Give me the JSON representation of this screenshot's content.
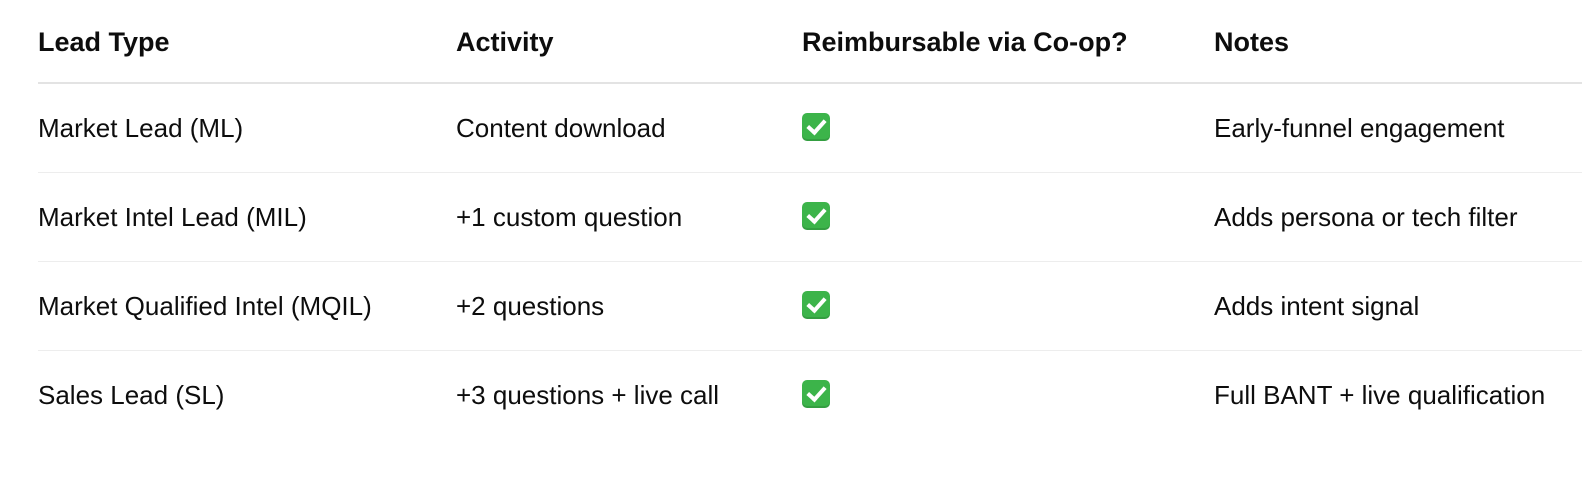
{
  "table": {
    "headers": [
      "Lead Type",
      "Activity",
      "Reimbursable via Co-op?",
      "Notes"
    ],
    "rows": [
      {
        "lead_type": "Market Lead (ML)",
        "activity": "Content download",
        "reimbursable": "checkmark-icon",
        "notes": "Early-funnel engagement"
      },
      {
        "lead_type": "Market Intel Lead (MIL)",
        "activity": "+1 custom question",
        "reimbursable": "checkmark-icon",
        "notes": "Adds persona or tech filter"
      },
      {
        "lead_type": "Market Qualified Intel (MQIL)",
        "activity": "+2 questions",
        "reimbursable": "checkmark-icon",
        "notes": "Adds intent signal"
      },
      {
        "lead_type": "Sales Lead (SL)",
        "activity": "+3 questions + live call",
        "reimbursable": "checkmark-icon",
        "notes": "Full BANT + live qualification"
      }
    ]
  },
  "colors": {
    "check_green": "#3cb44a",
    "text": "#0d0d0d",
    "divider": "#e3e3e3"
  }
}
